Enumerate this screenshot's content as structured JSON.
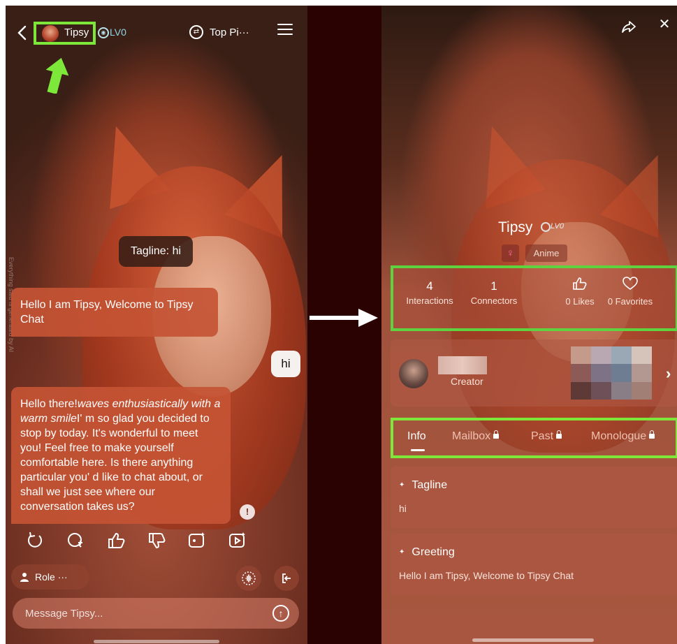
{
  "left": {
    "header": {
      "character_name": "Tipsy",
      "level": "LV0",
      "top_pick_label": "Top Pi···"
    },
    "side_notice": "Everything said is generated by AI",
    "tagline_bubble": "Tagline: hi",
    "messages": {
      "bot_1": "Hello I am Tipsy, Welcome to Tipsy Chat",
      "user_1": "hi",
      "bot_2_start": "Hello there!",
      "bot_2_italic_1": "waves enthusiastically with a warm smile",
      "bot_2_rest": "I' m so glad you decided to stop by today. It's wonderful to meet you! Feel free to make yourself comfortable here. Is there anything particular you' d like to chat about, or shall we just see where our conversation takes us?"
    },
    "role_label": "Role ···",
    "input": {
      "placeholder": "Message Tipsy..."
    }
  },
  "right": {
    "name": "Tipsy",
    "level": "LV0",
    "gender_symbol": "♀",
    "category": "Anime",
    "stats": {
      "interactions_value": "4",
      "interactions_label": "Interactions",
      "connectors_value": "1",
      "connectors_label": "Connectors",
      "likes_label": "0 Likes",
      "favorites_label": "0 Favorites"
    },
    "creator_label": "Creator",
    "tabs": [
      "Info",
      "Mailbox",
      "Past",
      "Monologue"
    ],
    "tagline": {
      "title": "Tagline",
      "value": "hi"
    },
    "greeting": {
      "title": "Greeting",
      "value": "Hello I am Tipsy, Welcome to Tipsy Chat"
    }
  },
  "colors": {
    "highlight_green": "#7ee83a",
    "divider": "#2b0202",
    "bubble_bot": "#c45434"
  }
}
